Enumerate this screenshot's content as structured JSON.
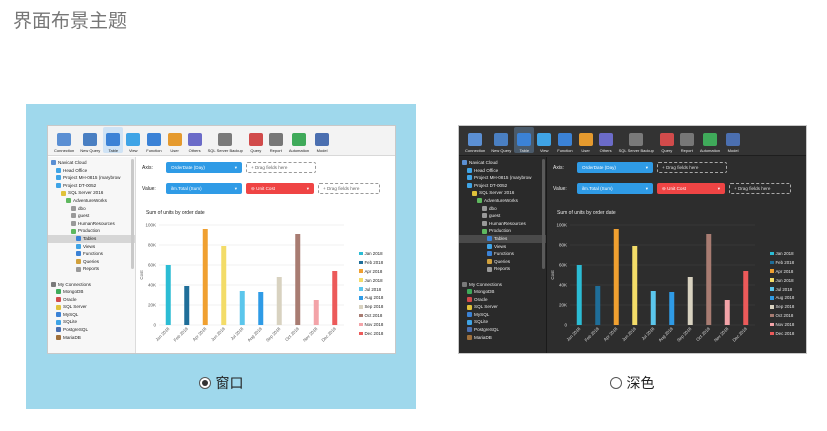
{
  "page": {
    "title": "界面布景主题"
  },
  "themes": [
    {
      "id": "light",
      "label": "窗口",
      "selected": true
    },
    {
      "id": "dark",
      "label": "深色",
      "selected": false
    }
  ],
  "toolbar": {
    "items": [
      {
        "label": "Connection",
        "icon": "connection-icon",
        "color": "#5b8fd3"
      },
      {
        "label": "New Query",
        "icon": "new-query-icon",
        "color": "#4a7fc2"
      },
      {
        "label": "Table",
        "icon": "table-icon",
        "color": "#3b82d6"
      },
      {
        "label": "View",
        "icon": "view-icon",
        "color": "#3fa4e6"
      },
      {
        "label": "Function",
        "icon": "function-icon",
        "color": "#3b82d6"
      },
      {
        "label": "User",
        "icon": "user-icon",
        "color": "#e59a2e"
      },
      {
        "label": "Others",
        "icon": "others-icon",
        "color": "#6b6bc8"
      },
      {
        "label": "SQL Server Backup",
        "icon": "backup-icon",
        "color": "#7a7a7a"
      },
      {
        "label": "Query",
        "icon": "query-icon",
        "color": "#d14b4b"
      },
      {
        "label": "Report",
        "icon": "report-icon",
        "color": "#777"
      },
      {
        "label": "Automation",
        "icon": "automation-icon",
        "color": "#3faa5a"
      },
      {
        "label": "Model",
        "icon": "model-icon",
        "color": "#4b6fb0"
      }
    ]
  },
  "tree": [
    {
      "label": "Navicat Cloud",
      "indent": 0,
      "color": "#5b8fd3"
    },
    {
      "label": "Head Office",
      "indent": 1,
      "color": "#3fa4e6"
    },
    {
      "label": "Project MH-0815 (marybrow",
      "indent": 1,
      "color": "#3fa4e6"
    },
    {
      "label": "Project DT-0052",
      "indent": 1,
      "color": "#3fa4e6"
    },
    {
      "label": "SQL Server 2016",
      "indent": 2,
      "color": "#e0c23a"
    },
    {
      "label": "AdventureWorks",
      "indent": 3,
      "color": "#5fb85f"
    },
    {
      "label": "dbo",
      "indent": 4,
      "color": "#999"
    },
    {
      "label": "guest",
      "indent": 4,
      "color": "#999"
    },
    {
      "label": "HumanResources",
      "indent": 4,
      "color": "#999"
    },
    {
      "label": "Production",
      "indent": 4,
      "color": "#5fb85f"
    },
    {
      "label": "Tables",
      "indent": 5,
      "color": "#3b82d6",
      "selected": true
    },
    {
      "label": "Views",
      "indent": 5,
      "color": "#3fa4e6"
    },
    {
      "label": "Functions",
      "indent": 5,
      "color": "#3b82d6"
    },
    {
      "label": "Queries",
      "indent": 5,
      "color": "#d1a03b"
    },
    {
      "label": "Reports",
      "indent": 5,
      "color": "#999"
    },
    {
      "label": "",
      "indent": 0,
      "color": "transparent"
    },
    {
      "label": "My Connections",
      "indent": 0,
      "color": "#7a7a7a"
    },
    {
      "label": "MongoDB",
      "indent": 1,
      "color": "#3faa5a"
    },
    {
      "label": "Oracle",
      "indent": 1,
      "color": "#d14b4b"
    },
    {
      "label": "SQL Server",
      "indent": 1,
      "color": "#e0c23a"
    },
    {
      "label": "MySQL",
      "indent": 1,
      "color": "#3b82d6"
    },
    {
      "label": "SQLite",
      "indent": 1,
      "color": "#3fa4e6"
    },
    {
      "label": "PostgreSQL",
      "indent": 1,
      "color": "#4b6fb0"
    },
    {
      "label": "MariaDB",
      "indent": 1,
      "color": "#a0703b"
    }
  ],
  "controls": {
    "axis_label": "Axis:",
    "axis_value": "OrderDate (Day)",
    "value_label": "Value:",
    "value_value": "ilm.Total (Sum)",
    "unit_cost": "Unit Cost",
    "drag_fields": "Drag fields here"
  },
  "chart_data": {
    "type": "bar",
    "title": "Sum of units by order date",
    "ylabel": "Cost",
    "ylim": [
      0,
      100000
    ],
    "yticks": [
      "0",
      "20K",
      "40K",
      "60K",
      "80K",
      "100K"
    ],
    "categories": [
      "Jan 2018",
      "Feb 2018",
      "Apr 2018",
      "Jun 2018",
      "Jul 2018",
      "Aug 2018",
      "Sep 2018",
      "Oct 2018",
      "Nov 2018",
      "Dec 2018"
    ],
    "values": [
      60000,
      39000,
      96000,
      79000,
      34000,
      33000,
      48000,
      91000,
      25000,
      54000
    ],
    "colors": [
      "#2bbcd4",
      "#1f6e99",
      "#f0a030",
      "#f3dc68",
      "#5bc6ec",
      "#2f9be6",
      "#d8d2c0",
      "#a87c72",
      "#f3a3a8",
      "#ec5a5a"
    ],
    "legend": [
      "Jan 2018",
      "Feb 2018",
      "Apr 2018",
      "Jun 2018",
      "Jul 2018",
      "Aug 2018",
      "Sep 2018",
      "Oct 2018",
      "Nov 2018",
      "Dec 2018"
    ]
  }
}
